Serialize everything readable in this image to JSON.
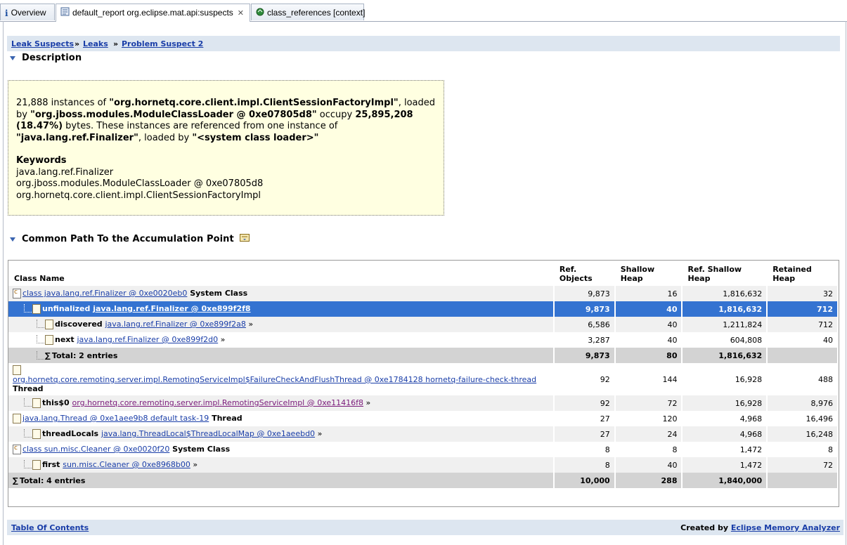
{
  "tabs": [
    {
      "label": "Overview"
    },
    {
      "label": "default_report  org.eclipse.mat.api:suspects"
    },
    {
      "label": "class_references [context]"
    }
  ],
  "breadcrumb": {
    "items": [
      "Leak Suspects",
      "Leaks",
      "Problem Suspect 2"
    ],
    "separator": "»"
  },
  "description": {
    "title": "Description",
    "p1_a": "21,888 instances of ",
    "p1_b": "\"org.hornetq.core.client.impl.ClientSessionFactoryImpl\"",
    "p1_c": ", loaded by ",
    "p1_d": "\"org.jboss.modules.ModuleClassLoader @ 0xe07805d8\"",
    "p1_e": " occupy ",
    "p1_f": "25,895,208 (18.47%)",
    "p1_g": " bytes. These instances are referenced from one instance of ",
    "p1_h": "\"java.lang.ref.Finalizer\"",
    "p1_i": ", loaded by ",
    "p1_j": "\"<system class loader>\"",
    "keywords_title": "Keywords",
    "keywords": [
      "java.lang.ref.Finalizer",
      "org.jboss.modules.ModuleClassLoader @ 0xe07805d8",
      "org.hornetq.core.client.impl.ClientSessionFactoryImpl"
    ]
  },
  "accum": {
    "title": "Common Path To the Accumulation Point",
    "columns": {
      "name": "Class Name",
      "ref_objects_1": "Ref.",
      "ref_objects_2": "Objects",
      "shallow_1": "Shallow",
      "shallow_2": "Heap",
      "ref_shallow_1": "Ref. Shallow",
      "ref_shallow_2": "Heap",
      "retained_1": "Retained",
      "retained_2": "Heap"
    },
    "rows": [
      {
        "prefix": "",
        "link": "class java.lang.ref.Finalizer @ 0xe0020eb0",
        "suffix": " System Class",
        "more": "",
        "ref": "9,873",
        "shallow": "16",
        "refshallow": "1,816,632",
        "retained": "32"
      },
      {
        "prefix": "unfinalized ",
        "link": "java.lang.ref.Finalizer @ 0xe899f2f8",
        "suffix": "",
        "more": "",
        "ref": "9,873",
        "shallow": "40",
        "refshallow": "1,816,632",
        "retained": "712"
      },
      {
        "prefix": "discovered ",
        "link": "java.lang.ref.Finalizer @ 0xe899f2a8",
        "suffix": "",
        "more": "»",
        "ref": "6,586",
        "shallow": "40",
        "refshallow": "1,211,824",
        "retained": "712"
      },
      {
        "prefix": "next ",
        "link": "java.lang.ref.Finalizer @ 0xe899f2d0",
        "suffix": "",
        "more": "»",
        "ref": "3,287",
        "shallow": "40",
        "refshallow": "604,808",
        "retained": "40"
      },
      {
        "prefix": "Total: 2 entries",
        "link": "",
        "suffix": "",
        "more": "",
        "ref": "9,873",
        "shallow": "80",
        "refshallow": "1,816,632",
        "retained": ""
      },
      {
        "prefix": "",
        "link": "org.hornetq.core.remoting.server.impl.RemotingServiceImpl$FailureCheckAndFlushThread @ 0xe1784128 hornetq-failure-check-thread",
        "suffix": "Thread",
        "more": "",
        "ref": "92",
        "shallow": "144",
        "refshallow": "16,928",
        "retained": "488"
      },
      {
        "prefix": "this$0 ",
        "link": "org.hornetq.core.remoting.server.impl.RemotingServiceImpl @ 0xe11416f8",
        "suffix": "",
        "more": "»",
        "ref": "92",
        "shallow": "72",
        "refshallow": "16,928",
        "retained": "8,976"
      },
      {
        "prefix": "",
        "link": "java.lang.Thread @ 0xe1aee9b8 default task-19",
        "suffix": " Thread",
        "more": "",
        "ref": "27",
        "shallow": "120",
        "refshallow": "4,968",
        "retained": "16,496"
      },
      {
        "prefix": "threadLocals ",
        "link": "java.lang.ThreadLocal$ThreadLocalMap @ 0xe1aeebd0",
        "suffix": "",
        "more": "»",
        "ref": "27",
        "shallow": "24",
        "refshallow": "4,968",
        "retained": "16,248"
      },
      {
        "prefix": "",
        "link": "class sun.misc.Cleaner @ 0xe0020f20",
        "suffix": " System Class",
        "more": "",
        "ref": "8",
        "shallow": "8",
        "refshallow": "1,472",
        "retained": "8"
      },
      {
        "prefix": "first ",
        "link": "sun.misc.Cleaner @ 0xe8968b00",
        "suffix": "",
        "more": "»",
        "ref": "8",
        "shallow": "40",
        "refshallow": "1,472",
        "retained": "72"
      },
      {
        "prefix": "Total: 4 entries",
        "link": "",
        "suffix": "",
        "more": "",
        "ref": "10,000",
        "shallow": "288",
        "refshallow": "1,840,000",
        "retained": ""
      }
    ]
  },
  "footer": {
    "toc": "Table Of Contents",
    "created_by": "Created by ",
    "created_link": "Eclipse Memory Analyzer"
  },
  "colors": {
    "selected_row": "#3473d1",
    "link": "#1a3ea8",
    "desc_bg": "#ffffe1"
  }
}
